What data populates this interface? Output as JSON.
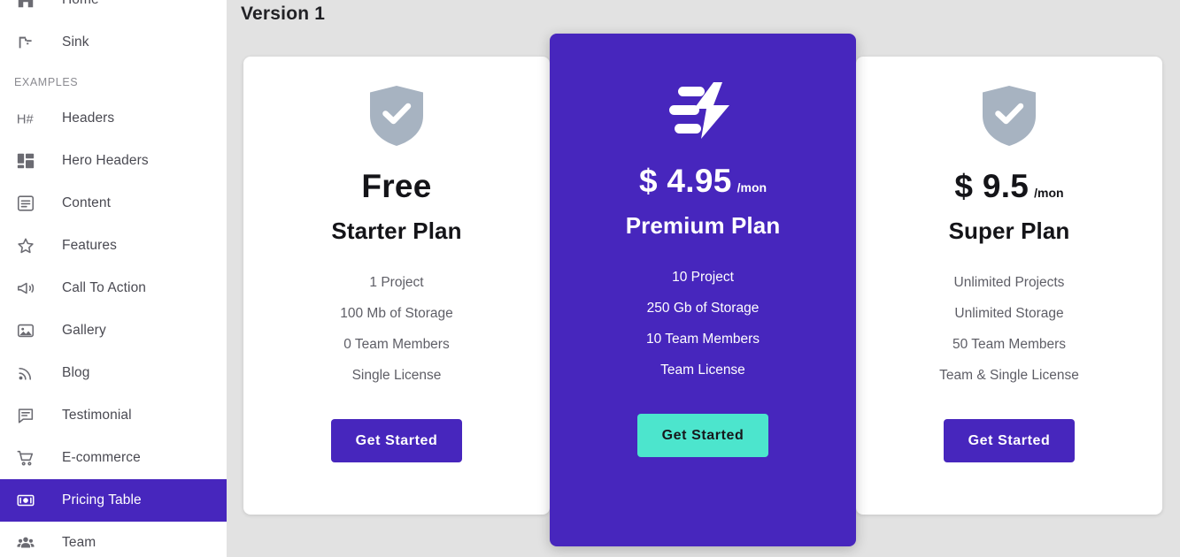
{
  "colors": {
    "brand_purple": "#4726bd",
    "accent_teal": "#4ce5cd",
    "page_background": "#e2e2e2",
    "card_background": "#ffffff",
    "shield_gray": "#a7b3c1"
  },
  "sidebar": {
    "items_top": [
      {
        "label": "Home",
        "icon": "home-icon",
        "active": false
      },
      {
        "label": "Sink",
        "icon": "faucet-icon",
        "active": false
      }
    ],
    "section_label": "EXAMPLES",
    "items_examples": [
      {
        "label": "Headers",
        "icon": "heading-hash-icon",
        "active": false
      },
      {
        "label": "Hero Headers",
        "icon": "layout-blocks-icon",
        "active": false
      },
      {
        "label": "Content",
        "icon": "article-lines-icon",
        "active": false
      },
      {
        "label": "Features",
        "icon": "star-outline-icon",
        "active": false
      },
      {
        "label": "Call To Action",
        "icon": "megaphone-icon",
        "active": false
      },
      {
        "label": "Gallery",
        "icon": "photos-icon",
        "active": false
      },
      {
        "label": "Blog",
        "icon": "rss-feed-icon",
        "active": false
      },
      {
        "label": "Testimonial",
        "icon": "speech-bubble-lines-icon",
        "active": false
      },
      {
        "label": "E-commerce",
        "icon": "shopping-cart-icon",
        "active": false
      },
      {
        "label": "Pricing Table",
        "icon": "money-cash-icon",
        "active": true
      },
      {
        "label": "Team",
        "icon": "people-group-icon",
        "active": false
      }
    ]
  },
  "main": {
    "title": "Version 1",
    "cards": [
      {
        "id": "starter",
        "featured": false,
        "icon": "shield-check-icon",
        "price": "Free",
        "per": "",
        "plan_name": "Starter Plan",
        "features": [
          "1 Project",
          "100 Mb of Storage",
          "0 Team Members",
          "Single License"
        ],
        "cta_label": "Get Started"
      },
      {
        "id": "premium",
        "featured": true,
        "icon": "flash-speed-icon",
        "price": "$ 4.95",
        "per": "/mon",
        "plan_name": "Premium Plan",
        "features": [
          "10 Project",
          "250 Gb of Storage",
          "10 Team Members",
          "Team License"
        ],
        "cta_label": "Get Started"
      },
      {
        "id": "super",
        "featured": false,
        "icon": "shield-check-icon",
        "price": "$ 9.5",
        "per": "/mon",
        "plan_name": "Super Plan",
        "features": [
          "Unlimited Projects",
          "Unlimited Storage",
          "50 Team Members",
          "Team & Single License"
        ],
        "cta_label": "Get Started"
      }
    ]
  }
}
